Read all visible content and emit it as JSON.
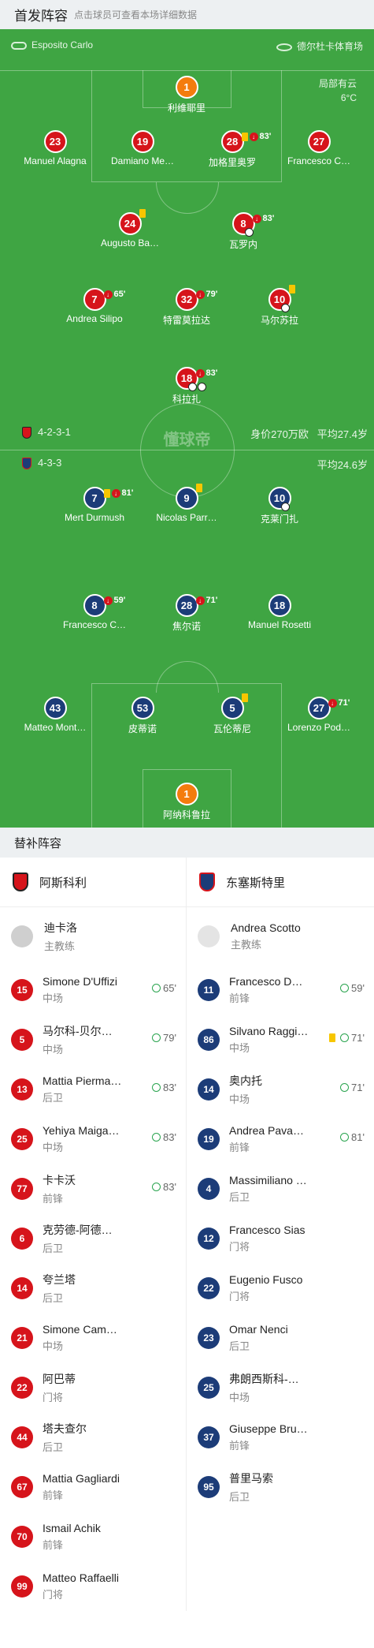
{
  "header": {
    "title": "首发阵容",
    "hint": "点击球员可查看本场详细数据"
  },
  "match": {
    "referee": "Esposito Carlo",
    "stadium": "德尔杜卡体育场",
    "weather": "局部有云",
    "temperature": "6°C",
    "watermark": "懂球帝"
  },
  "home": {
    "formation": "4-2-3-1",
    "value": "身价270万欧",
    "avg_age": "平均27.4岁",
    "color": "#d6141b",
    "players": [
      {
        "num": "1",
        "name": "利维耶里",
        "kind": "gk"
      },
      {
        "num": "23",
        "name": "Manuel Alagna"
      },
      {
        "num": "19",
        "name": "Damiano Me…"
      },
      {
        "num": "28",
        "name": "加格里奥罗",
        "yellow": true,
        "sub": true,
        "min": "83'"
      },
      {
        "num": "27",
        "name": "Francesco C…"
      },
      {
        "num": "24",
        "name": "Augusto Ba…",
        "yellow": true
      },
      {
        "num": "8",
        "name": "瓦罗内",
        "sub": true,
        "min": "83'",
        "goals": 1
      },
      {
        "num": "7",
        "name": "Andrea Silipo",
        "sub": true,
        "min": "65'"
      },
      {
        "num": "32",
        "name": "特雷莫拉达",
        "sub": true,
        "min": "79'"
      },
      {
        "num": "10",
        "name": "马尔苏拉",
        "yellow": true,
        "goals": 1
      },
      {
        "num": "18",
        "name": "科拉扎",
        "sub": true,
        "min": "83'",
        "goals": 2
      }
    ]
  },
  "away": {
    "formation": "4-3-3",
    "avg_age": "平均24.6岁",
    "color": "#1c3c78",
    "players": [
      {
        "num": "7",
        "name": "Mert Durmush",
        "yellow": true,
        "sub": true,
        "min": "81'"
      },
      {
        "num": "9",
        "name": "Nicolas Parr…",
        "yellow": true
      },
      {
        "num": "10",
        "name": "克莱门扎",
        "goals": 1
      },
      {
        "num": "8",
        "name": "Francesco C…",
        "sub": true,
        "min": "59'"
      },
      {
        "num": "28",
        "name": "焦尔诺",
        "sub": true,
        "min": "71'"
      },
      {
        "num": "18",
        "name": "Manuel Rosetti"
      },
      {
        "num": "43",
        "name": "Matteo Mont…"
      },
      {
        "num": "53",
        "name": "皮蒂诺"
      },
      {
        "num": "5",
        "name": "瓦伦蒂尼",
        "yellow": true
      },
      {
        "num": "27",
        "name": "Lorenzo Pod…",
        "sub": true,
        "min": "71'"
      },
      {
        "num": "1",
        "name": "阿纳科鲁拉",
        "kind": "gk"
      }
    ]
  },
  "subs": {
    "title": "替补阵容",
    "home_team": "阿斯科利",
    "away_team": "东塞斯特里",
    "home_coach": {
      "name": "迪卡洛",
      "role": "主教练"
    },
    "away_coach": {
      "name": "Andrea Scotto",
      "role": "主教练"
    },
    "home": [
      {
        "num": "15",
        "name": "Simone D'Uffizi",
        "pos": "中场",
        "min": "65'"
      },
      {
        "num": "5",
        "name": "马尔科-贝尔…",
        "pos": "中场",
        "min": "79'"
      },
      {
        "num": "13",
        "name": "Mattia Pierma…",
        "pos": "后卫",
        "min": "83'"
      },
      {
        "num": "25",
        "name": "Yehiya Maiga…",
        "pos": "中场",
        "min": "83'"
      },
      {
        "num": "77",
        "name": "卡卡沃",
        "pos": "前锋",
        "min": "83'"
      },
      {
        "num": "6",
        "name": "克劳德-阿德…",
        "pos": "后卫"
      },
      {
        "num": "14",
        "name": "夸兰塔",
        "pos": "后卫"
      },
      {
        "num": "21",
        "name": "Simone Cam…",
        "pos": "中场"
      },
      {
        "num": "22",
        "name": "阿巴蒂",
        "pos": "门将"
      },
      {
        "num": "44",
        "name": "塔夫查尔",
        "pos": "后卫"
      },
      {
        "num": "67",
        "name": "Mattia Gagliardi",
        "pos": "前锋"
      },
      {
        "num": "70",
        "name": "Ismail Achik",
        "pos": "前锋"
      },
      {
        "num": "99",
        "name": "Matteo Raffaelli",
        "pos": "门将"
      }
    ],
    "away": [
      {
        "num": "11",
        "name": "Francesco D…",
        "pos": "前锋",
        "min": "59'"
      },
      {
        "num": "86",
        "name": "Silvano Raggi…",
        "pos": "中场",
        "min": "71'",
        "yellow": true
      },
      {
        "num": "14",
        "name": "奥内托",
        "pos": "中场",
        "min": "71'"
      },
      {
        "num": "19",
        "name": "Andrea Pava…",
        "pos": "前锋",
        "min": "81'"
      },
      {
        "num": "4",
        "name": "Massimiliano …",
        "pos": "后卫"
      },
      {
        "num": "12",
        "name": "Francesco Sias",
        "pos": "门将"
      },
      {
        "num": "22",
        "name": "Eugenio Fusco",
        "pos": "门将"
      },
      {
        "num": "23",
        "name": "Omar Nenci",
        "pos": "后卫"
      },
      {
        "num": "25",
        "name": "弗朗西斯科-…",
        "pos": "中场"
      },
      {
        "num": "37",
        "name": "Giuseppe Bru…",
        "pos": "前锋"
      },
      {
        "num": "95",
        "name": "普里马索",
        "pos": "后卫"
      }
    ]
  }
}
